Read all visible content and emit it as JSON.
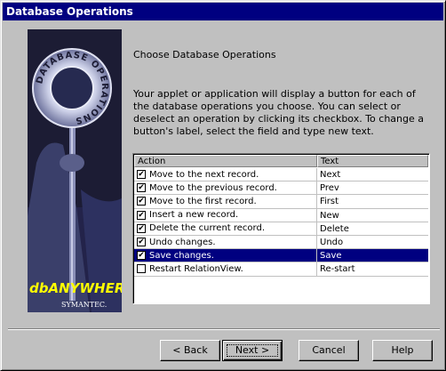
{
  "window": {
    "title": "Database Operations"
  },
  "banner": {
    "ring_text": "DATABASE OPERATIONS",
    "logo_text": "dbANYWHERE",
    "brand_text": "SYMANTEC."
  },
  "heading": "Choose Database Operations",
  "description": "Your applet or application will display a button for each of the database operations you choose. You can select or deselect an operation by clicking its checkbox. To change a button's label, select the field and type new text.",
  "table": {
    "columns": [
      "Action",
      "Text"
    ],
    "rows": [
      {
        "checked": true,
        "action": "Move to the next record.",
        "text": "Next",
        "selected": false
      },
      {
        "checked": true,
        "action": "Move to the previous record.",
        "text": "Prev",
        "selected": false
      },
      {
        "checked": true,
        "action": "Move to the first record.",
        "text": "First",
        "selected": false
      },
      {
        "checked": true,
        "action": "Insert a new record.",
        "text": "New",
        "selected": false
      },
      {
        "checked": true,
        "action": "Delete the current record.",
        "text": "Delete",
        "selected": false
      },
      {
        "checked": true,
        "action": "Undo changes.",
        "text": "Undo",
        "selected": false
      },
      {
        "checked": true,
        "action": "Save changes.",
        "text": "Save",
        "selected": true
      },
      {
        "checked": false,
        "action": "Restart RelationView.",
        "text": "Re-start",
        "selected": false
      }
    ]
  },
  "buttons": {
    "back": "< Back",
    "next": "Next >",
    "cancel": "Cancel",
    "help": "Help"
  },
  "colors": {
    "titlebar": "#000080",
    "selection": "#000080",
    "face": "#c0c0c0",
    "logo": "#ffff00"
  }
}
